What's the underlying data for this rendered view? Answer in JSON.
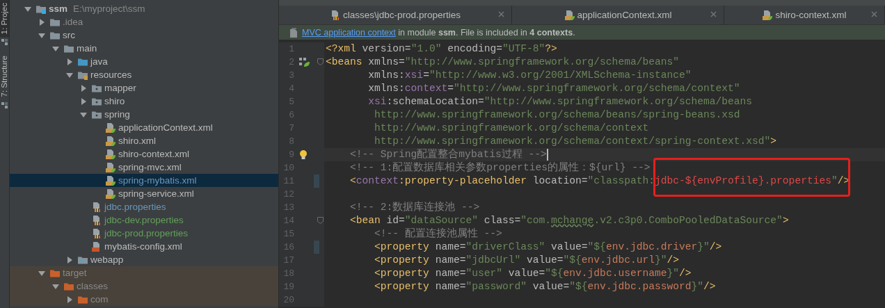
{
  "tool_windows": [
    {
      "label": "1: Projec",
      "selected": true
    },
    {
      "label": "7: Structure",
      "selected": false
    }
  ],
  "project_tree": {
    "nodes": [
      {
        "name": "ssm",
        "path": "E:\\myproject\\ssm",
        "kind": "module",
        "color": "#bbbbbb",
        "expanded": true,
        "selected": false,
        "children": [
          {
            "name": ".idea",
            "kind": "folder",
            "color": "#8a8a8a",
            "expanded": false,
            "selected": false
          },
          {
            "name": "src",
            "kind": "folder",
            "color": "#bbbbbb",
            "expanded": true,
            "selected": false,
            "children": [
              {
                "name": "main",
                "kind": "folder",
                "color": "#bbbbbb",
                "expanded": true,
                "selected": false,
                "children": [
                  {
                    "name": "java",
                    "kind": "source-folder",
                    "color": "#bbbbbb",
                    "expanded": false,
                    "selected": false
                  },
                  {
                    "name": "resources",
                    "kind": "resources-folder",
                    "color": "#bbbbbb",
                    "expanded": true,
                    "selected": false,
                    "children": [
                      {
                        "name": "mapper",
                        "kind": "package",
                        "color": "#bbbbbb",
                        "expanded": false,
                        "selected": false
                      },
                      {
                        "name": "shiro",
                        "kind": "package",
                        "color": "#bbbbbb",
                        "expanded": false,
                        "selected": false
                      },
                      {
                        "name": "spring",
                        "kind": "package",
                        "color": "#bbbbbb",
                        "expanded": true,
                        "selected": false,
                        "children": [
                          {
                            "name": "applicationContext.xml",
                            "kind": "spring-xml",
                            "color": "#bbbbbb",
                            "selected": false
                          },
                          {
                            "name": "shiro.xml",
                            "kind": "spring-xml",
                            "color": "#bbbbbb",
                            "selected": false
                          },
                          {
                            "name": "shiro-context.xml",
                            "kind": "spring-xml",
                            "color": "#bbbbbb",
                            "selected": false
                          },
                          {
                            "name": "spring-mvc.xml",
                            "kind": "spring-xml",
                            "color": "#bbbbbb",
                            "selected": false
                          },
                          {
                            "name": "spring-mybatis.xml",
                            "kind": "spring-xml",
                            "color": "#6897bb",
                            "selected": true
                          },
                          {
                            "name": "spring-service.xml",
                            "kind": "spring-xml",
                            "color": "#bbbbbb",
                            "selected": false
                          }
                        ]
                      },
                      {
                        "name": "jdbc.properties",
                        "kind": "properties",
                        "color": "#6897bb",
                        "selected": false
                      },
                      {
                        "name": "jdbc-dev.properties",
                        "kind": "properties",
                        "color": "#62a05a",
                        "selected": false
                      },
                      {
                        "name": "jdbc-prod.properties",
                        "kind": "properties",
                        "color": "#62a05a",
                        "selected": false
                      },
                      {
                        "name": "mybatis-config.xml",
                        "kind": "xml",
                        "color": "#bbbbbb",
                        "selected": false
                      }
                    ]
                  },
                  {
                    "name": "webapp",
                    "kind": "web-folder",
                    "color": "#bbbbbb",
                    "expanded": false,
                    "selected": false
                  }
                ]
              }
            ]
          },
          {
            "name": "target",
            "kind": "excluded-folder",
            "color": "#8a8a8a",
            "expanded": true,
            "selected": false,
            "children": [
              {
                "name": "classes",
                "kind": "excluded-folder",
                "color": "#8a8a8a",
                "expanded": true,
                "selected": false,
                "children": [
                  {
                    "name": "com",
                    "kind": "excluded-folder",
                    "color": "#8a8a8a",
                    "expanded": false,
                    "selected": false
                  }
                ]
              }
            ]
          }
        ]
      }
    ]
  },
  "editor": {
    "tabs": [
      {
        "label": "classes\\jdbc-prod.properties",
        "kind": "properties",
        "selected": false
      },
      {
        "label": "applicationContext.xml",
        "kind": "spring-xml",
        "selected": false
      },
      {
        "label": "shiro-context.xml",
        "kind": "spring-xml",
        "selected": false
      }
    ],
    "banner": {
      "link": "MVC application context",
      "text": " in module **ssm**. File is included in **4 contexts**."
    },
    "lines": [
      {
        "number": "1",
        "kind": "plain",
        "fold": false,
        "changed": false,
        "current": false,
        "tokens": [
          {
            "kind": "tag",
            "text": "<?xml"
          },
          {
            "kind": "attr",
            "text": " version="
          },
          {
            "kind": "str",
            "text": "\"1.0\""
          },
          {
            "kind": "attr",
            "text": " encoding="
          },
          {
            "kind": "str",
            "text": "\"UTF-8\""
          },
          {
            "kind": "tag",
            "text": "?>"
          }
        ]
      },
      {
        "number": "2",
        "kind": "bean",
        "fold": true,
        "changed": false,
        "current": false,
        "tokens": [
          {
            "kind": "tag",
            "text": "<beans"
          },
          {
            "kind": "attr",
            "text": " xmlns="
          },
          {
            "kind": "str",
            "text": "\"http://www.springframework.org/schema/beans\""
          }
        ]
      },
      {
        "number": "3",
        "kind": "plain",
        "fold": false,
        "changed": false,
        "current": false,
        "tokens": [
          {
            "kind": "attr",
            "text": "       xmlns:"
          },
          {
            "kind": "ns",
            "text": "xsi"
          },
          {
            "kind": "attr",
            "text": "="
          },
          {
            "kind": "str",
            "text": "\"http://www.w3.org/2001/XMLSchema-instance\""
          }
        ]
      },
      {
        "number": "4",
        "kind": "plain",
        "fold": false,
        "changed": false,
        "current": false,
        "tokens": [
          {
            "kind": "attr",
            "text": "       xmlns:"
          },
          {
            "kind": "ns",
            "text": "context"
          },
          {
            "kind": "attr",
            "text": "="
          },
          {
            "kind": "str",
            "text": "\"http://www.springframework.org/schema/context\""
          }
        ]
      },
      {
        "number": "5",
        "kind": "plain",
        "fold": false,
        "changed": false,
        "current": false,
        "tokens": [
          {
            "kind": "ns",
            "text": "       xsi"
          },
          {
            "kind": "attr",
            "text": ":schemaLocation="
          },
          {
            "kind": "str",
            "text": "\"http://www.springframework.org/schema/beans"
          }
        ]
      },
      {
        "number": "6",
        "kind": "plain",
        "fold": false,
        "changed": false,
        "current": false,
        "tokens": [
          {
            "kind": "str",
            "text": "        http://www.springframework.org/schema/beans/spring-beans.xsd"
          }
        ]
      },
      {
        "number": "7",
        "kind": "plain",
        "fold": false,
        "changed": false,
        "current": false,
        "tokens": [
          {
            "kind": "str",
            "text": "        http://www.springframework.org/schema/context"
          }
        ]
      },
      {
        "number": "8",
        "kind": "plain",
        "fold": false,
        "changed": false,
        "current": false,
        "tokens": [
          {
            "kind": "str",
            "text": "        http://www.springframework.org/schema/context/spring-context.xsd\""
          },
          {
            "kind": "tag",
            "text": ">"
          }
        ]
      },
      {
        "number": "9",
        "kind": "bulb",
        "fold": false,
        "changed": false,
        "current": true,
        "tokens": [
          {
            "kind": "comment",
            "text": "    <!-- Spring配置整合mybatis过程 -->"
          }
        ]
      },
      {
        "number": "10",
        "kind": "plain",
        "fold": false,
        "changed": false,
        "current": false,
        "tokens": [
          {
            "kind": "comment",
            "text": "    <!-- 1:配置数据库相关参数properties的属性：${url} -->"
          }
        ]
      },
      {
        "number": "11",
        "kind": "plain",
        "fold": false,
        "changed": true,
        "current": false,
        "tokens": [
          {
            "kind": "tag",
            "text": "    <"
          },
          {
            "kind": "ns",
            "text": "context"
          },
          {
            "kind": "tag",
            "text": ":property-placeholder"
          },
          {
            "kind": "attr",
            "text": " location="
          },
          {
            "kind": "str",
            "text": "\"classpath:"
          },
          {
            "kind": "error",
            "text": "jdbc-${envProfile}.properties"
          },
          {
            "kind": "str",
            "text": "\""
          },
          {
            "kind": "tag",
            "text": "/>"
          }
        ]
      },
      {
        "number": "12",
        "kind": "plain",
        "fold": false,
        "changed": false,
        "current": false
      },
      {
        "number": "13",
        "kind": "plain",
        "fold": false,
        "changed": false,
        "current": false,
        "tokens": [
          {
            "kind": "comment",
            "text": "    <!-- 2:数据库连接池 -->"
          }
        ]
      },
      {
        "number": "14",
        "kind": "plain",
        "fold": true,
        "changed": false,
        "current": false,
        "tokens": [
          {
            "kind": "tag",
            "text": "    <bean"
          },
          {
            "kind": "attr",
            "text": " id="
          },
          {
            "kind": "str",
            "text": "\"dataSource\""
          },
          {
            "kind": "attr",
            "text": " class="
          },
          {
            "kind": "str",
            "text": "\"com."
          },
          {
            "kind": "typo",
            "text": "mchange"
          },
          {
            "kind": "str",
            "text": ".v2.c3p0.ComboPooledDataSource\""
          },
          {
            "kind": "tag",
            "text": ">"
          }
        ]
      },
      {
        "number": "15",
        "kind": "plain",
        "fold": false,
        "changed": false,
        "current": false,
        "tokens": [
          {
            "kind": "comment",
            "text": "        <!-- 配置连接池属性 -->"
          }
        ]
      },
      {
        "number": "16",
        "kind": "plain",
        "fold": false,
        "changed": true,
        "current": false,
        "tokens": [
          {
            "kind": "tag",
            "text": "        <property"
          },
          {
            "kind": "attr",
            "text": " name="
          },
          {
            "kind": "str",
            "text": "\"driverClass\""
          },
          {
            "kind": "attr",
            "text": " value="
          },
          {
            "kind": "str",
            "text": "\"${"
          },
          {
            "kind": "ref",
            "text": "env.jdbc.driver"
          },
          {
            "kind": "str",
            "text": "}\""
          },
          {
            "kind": "tag",
            "text": "/>"
          }
        ]
      },
      {
        "number": "17",
        "kind": "plain",
        "fold": false,
        "changed": false,
        "current": false,
        "tokens": [
          {
            "kind": "tag",
            "text": "        <property"
          },
          {
            "kind": "attr",
            "text": " name="
          },
          {
            "kind": "str",
            "text": "\"jdbcUrl\""
          },
          {
            "kind": "attr",
            "text": " value="
          },
          {
            "kind": "str",
            "text": "\"${"
          },
          {
            "kind": "ref",
            "text": "env.jdbc.url"
          },
          {
            "kind": "str",
            "text": "}\""
          },
          {
            "kind": "tag",
            "text": "/>"
          }
        ]
      },
      {
        "number": "18",
        "kind": "plain",
        "fold": false,
        "changed": false,
        "current": false,
        "tokens": [
          {
            "kind": "tag",
            "text": "        <property"
          },
          {
            "kind": "attr",
            "text": " name="
          },
          {
            "kind": "str",
            "text": "\"user\""
          },
          {
            "kind": "attr",
            "text": " value="
          },
          {
            "kind": "str",
            "text": "\"${"
          },
          {
            "kind": "ref",
            "text": "env.jdbc.username"
          },
          {
            "kind": "str",
            "text": "}\""
          },
          {
            "kind": "tag",
            "text": "/>"
          }
        ]
      },
      {
        "number": "19",
        "kind": "plain",
        "fold": false,
        "changed": false,
        "current": false,
        "tokens": [
          {
            "kind": "tag",
            "text": "        <property"
          },
          {
            "kind": "attr",
            "text": " name="
          },
          {
            "kind": "str",
            "text": "\"password\""
          },
          {
            "kind": "attr",
            "text": " value="
          },
          {
            "kind": "str",
            "text": "\"${"
          },
          {
            "kind": "ref",
            "text": "env.jdbc.password"
          },
          {
            "kind": "str",
            "text": "}\""
          },
          {
            "kind": "tag",
            "text": "/>"
          }
        ]
      },
      {
        "number": "20",
        "kind": "plain",
        "fold": false,
        "changed": false,
        "current": false
      }
    ]
  }
}
